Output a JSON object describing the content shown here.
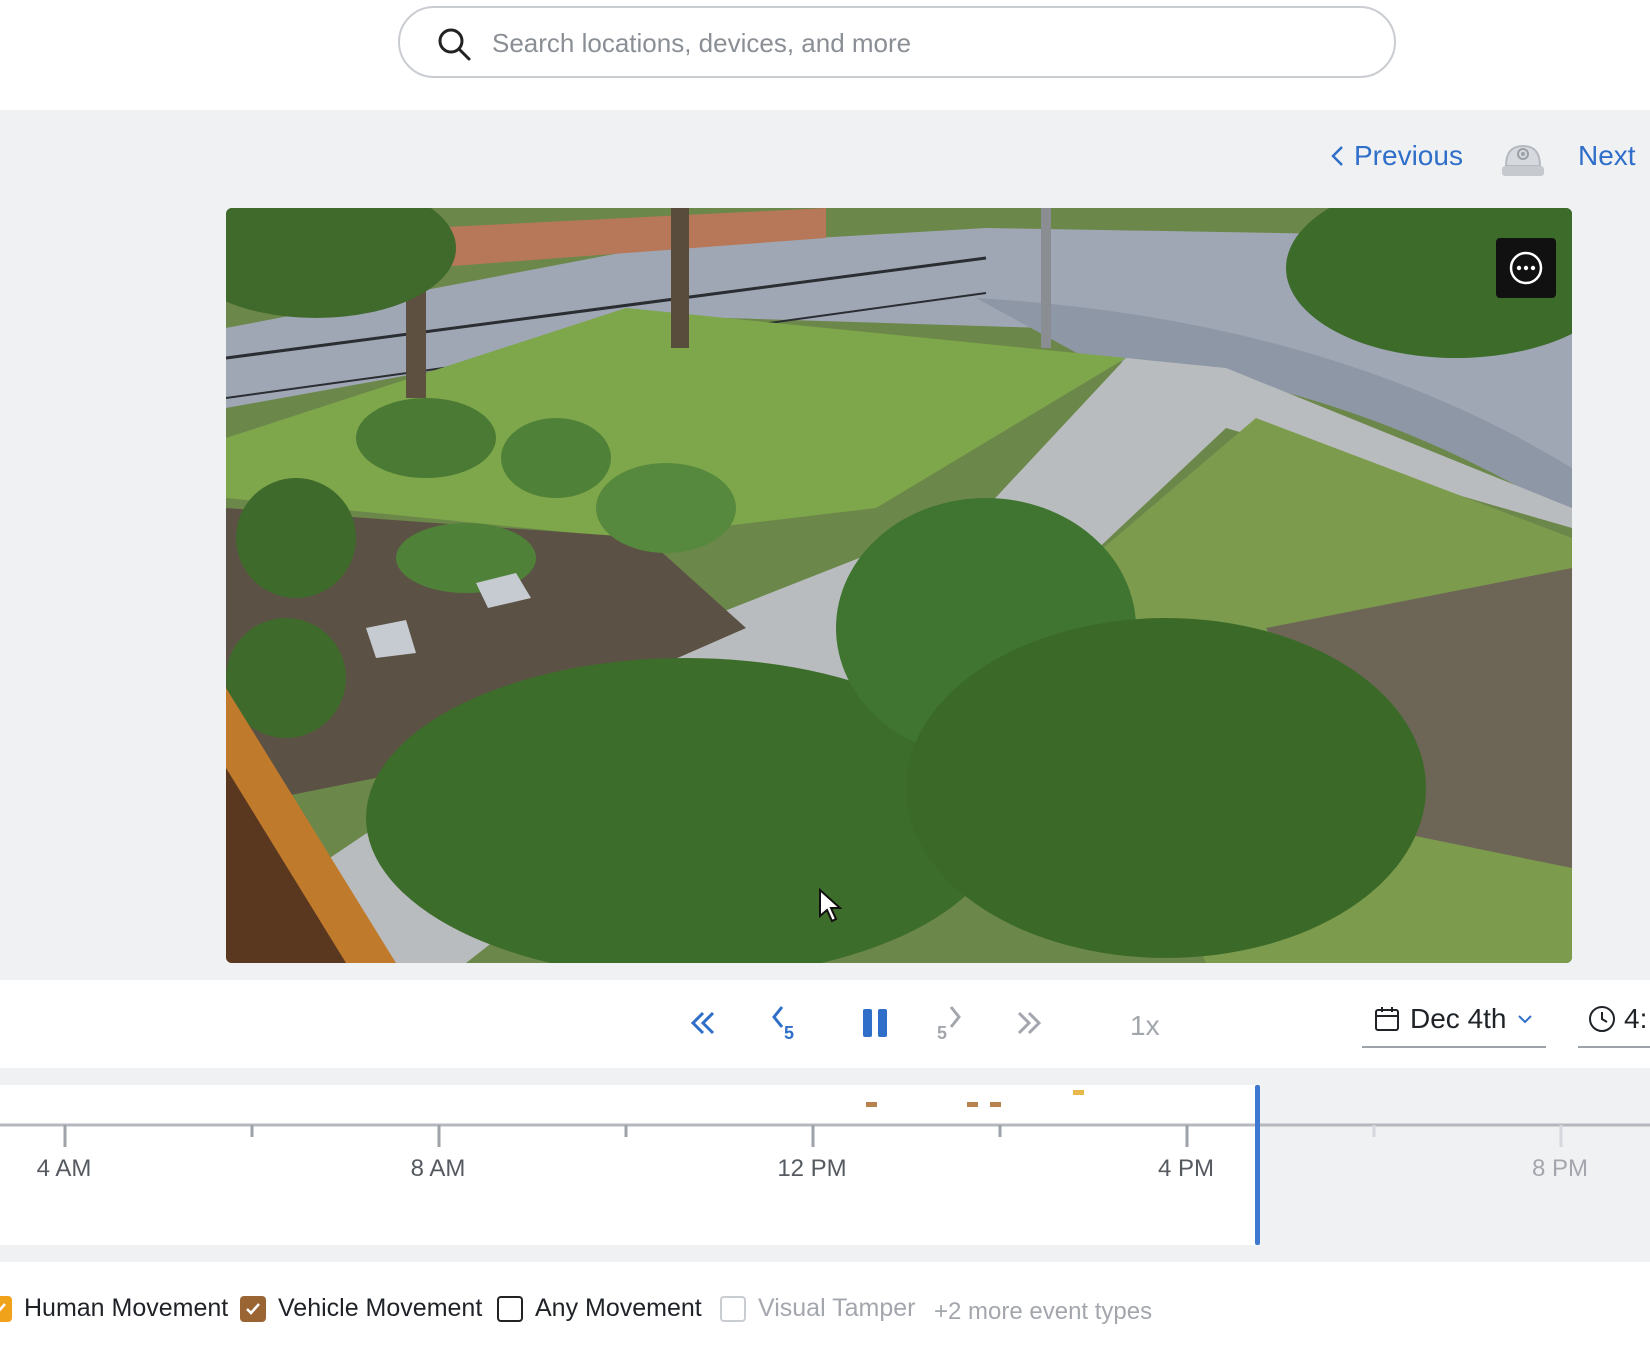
{
  "search": {
    "placeholder": "Search locations, devices, and more"
  },
  "navigation": {
    "previous_label": "Previous",
    "next_label": "Next"
  },
  "playback": {
    "speed": "1x",
    "skip_back_seconds": "5",
    "skip_forward_seconds": "5",
    "date": "Dec 4th",
    "time_partial": "4:"
  },
  "timeline": {
    "ticks": [
      {
        "label": "4 AM",
        "future": false
      },
      {
        "label": "8 AM",
        "future": false
      },
      {
        "label": "12 PM",
        "future": false
      },
      {
        "label": "4 PM",
        "future": false
      },
      {
        "label": "8 PM",
        "future": true
      }
    ]
  },
  "filters": {
    "human_movement": {
      "label": "Human Movement",
      "checked": true,
      "color": "#f0a21a"
    },
    "vehicle_movement": {
      "label": "Vehicle Movement",
      "checked": true,
      "color": "#9a6533"
    },
    "any_movement": {
      "label": "Any Movement",
      "checked": false
    },
    "visual_tamper": {
      "label": "Visual Tamper",
      "checked": false,
      "disabled": true
    },
    "more_types": "+2 more event types"
  },
  "colors": {
    "accent": "#2f6fc9",
    "playhead": "#3f78d0"
  }
}
